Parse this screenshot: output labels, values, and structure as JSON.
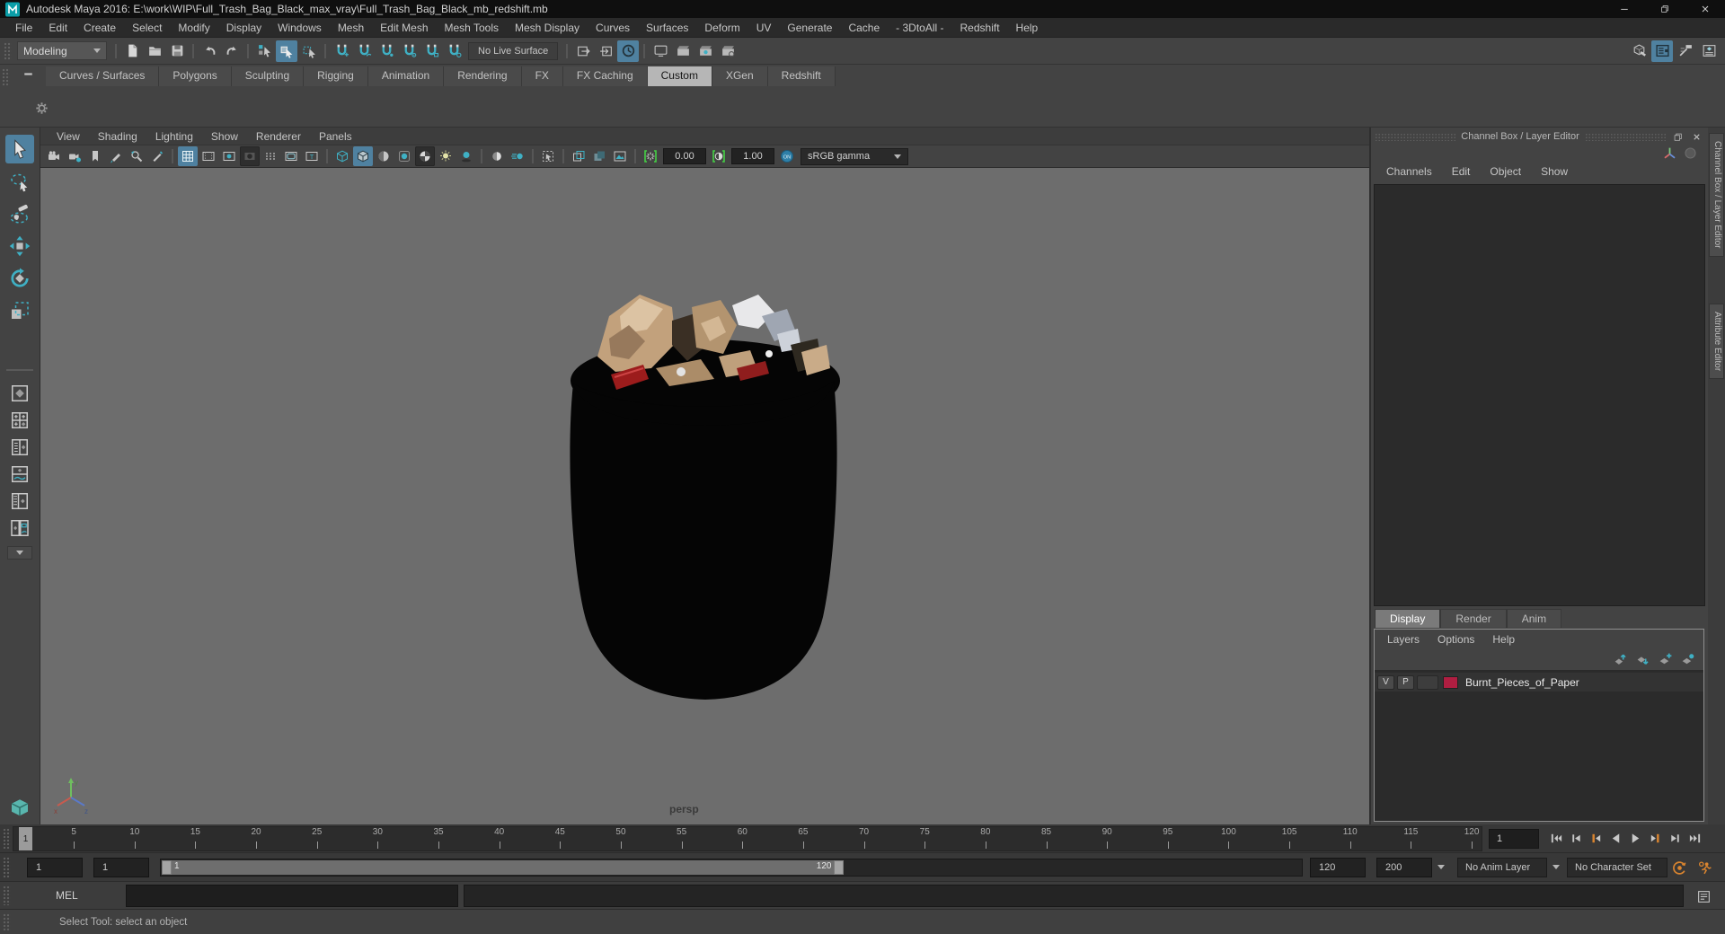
{
  "window": {
    "title": "Autodesk Maya 2016: E:\\work\\WIP\\Full_Trash_Bag_Black_max_vray\\Full_Trash_Bag_Black_mb_redshift.mb",
    "controls": [
      "minimize",
      "maximize",
      "close"
    ]
  },
  "menubar": {
    "items": [
      "File",
      "Edit",
      "Create",
      "Select",
      "Modify",
      "Display",
      "Windows",
      "Mesh",
      "Edit Mesh",
      "Mesh Tools",
      "Mesh Display",
      "Curves",
      "Surfaces",
      "Deform",
      "UV",
      "Generate",
      "Cache",
      "- 3DtoAll -",
      "Redshift",
      "Help"
    ]
  },
  "statusline": {
    "mode": "Modeling",
    "live_surface_label": "No Live Surface",
    "groups": [
      [
        "new-scene",
        "open-scene",
        "save-scene"
      ],
      [
        "undo",
        "redo"
      ],
      [
        "select-hierarchy",
        {
          "name": "select-object",
          "hl": "blue"
        },
        "select-component"
      ],
      [
        "snap-grid",
        "snap-curve",
        "snap-point",
        "snap-projected-center",
        "snap-view-plane",
        "make-live"
      ]
    ],
    "groups_after_live": [
      [
        "input-connections",
        "output-connections",
        {
          "name": "construction-history",
          "hl": "blue"
        }
      ],
      [
        "render-view",
        "render-current-frame",
        "ipr-render",
        "render-settings"
      ]
    ],
    "right_icons": [
      "modeling-toolkit",
      {
        "name": "attribute-editor",
        "hl": "blue"
      },
      "tool-settings",
      "channel-box"
    ]
  },
  "shelf": {
    "tabs": [
      "Curves / Surfaces",
      "Polygons",
      "Sculpting",
      "Rigging",
      "Animation",
      "Rendering",
      "FX",
      "FX Caching",
      "Custom",
      "XGen",
      "Redshift"
    ],
    "active": "Custom",
    "left_icons": [
      "shelf-menu"
    ],
    "area_icons": [
      "gear"
    ]
  },
  "toolbox": {
    "tools": [
      {
        "name": "select",
        "hl": "blue"
      },
      "lasso",
      "paint-select",
      "move",
      "rotate",
      "scale"
    ],
    "layouts": [
      "layout-single",
      "layout-four",
      "layout-two-vertical",
      "layout-two-horizontal",
      "layout-three",
      "layout-pair"
    ],
    "bottom": [
      "view-cube"
    ]
  },
  "viewport": {
    "menus": [
      "View",
      "Shading",
      "Lighting",
      "Show",
      "Renderer",
      "Panels"
    ],
    "toolbar_groups": [
      [
        "camera",
        "camera-attributes",
        "bookmark",
        "grease-pencil",
        "pan-zoom",
        "snapshot"
      ],
      [
        {
          "name": "grid",
          "hl": "blue"
        },
        "film-gate",
        "resolution-gate",
        {
          "name": "gate-mask",
          "hl": "dark"
        },
        "field-chart",
        "safe-action",
        "safe-title"
      ],
      [
        "wireframe-cube",
        {
          "name": "smooth-shade",
          "hl": "blue"
        },
        "flat-shade",
        "default-material",
        {
          "name": "textured",
          "hl": "dark"
        },
        "lights",
        "shadows"
      ],
      [
        "screen-space-ao",
        "motion-blur"
      ],
      [
        "isolate-select"
      ],
      [
        "overlap-planes",
        "stacked-planes",
        "image-plane"
      ]
    ],
    "exposure_icon": [
      "exposure"
    ],
    "contrast_icon": [
      "contrast"
    ],
    "on_icon": [
      "on-toggle"
    ],
    "exposure_label": "0.00",
    "contrast_label": "1.00",
    "gamma_mode": "sRGB gamma",
    "camera_label": "persp"
  },
  "channel_box": {
    "title": "Channel Box / Layer Editor",
    "header_icons": [
      "restore",
      "close-panel"
    ],
    "corner_icons": [
      "manip-axis",
      "speed-circle"
    ],
    "menus": [
      "Channels",
      "Edit",
      "Object",
      "Show"
    ],
    "side_tabs": [
      "Channel Box / Layer Editor",
      "Attribute Editor"
    ]
  },
  "layer_editor": {
    "tabs": [
      "Display",
      "Render",
      "Anim"
    ],
    "active_tab": "Display",
    "menus": [
      "Layers",
      "Options",
      "Help"
    ],
    "icons": [
      "move-layer-up",
      "move-layer-down",
      "create-empty-layer",
      "create-layer-from-selection"
    ],
    "layers": [
      {
        "visible": "V",
        "playback": "P",
        "color": "#b01e41",
        "name": "Burnt_Pieces_of_Paper"
      }
    ]
  },
  "timeline": {
    "current_frame": "1",
    "tick_labels": [
      5,
      10,
      15,
      20,
      25,
      30,
      35,
      40,
      45,
      50,
      55,
      60,
      65,
      70,
      75,
      80,
      85,
      90,
      95,
      100,
      105,
      110,
      115,
      120
    ],
    "range_start": 1,
    "range_end": 120,
    "current_time_field": "1",
    "playback_icons": [
      "go-to-start",
      "step-back",
      "previous-key",
      "play-backwards",
      "play-forwards",
      "next-key",
      "step-forward",
      "go-to-end"
    ]
  },
  "range_slider": {
    "animation_start": "1",
    "playback_start": "1",
    "playback_end": "120",
    "animation_end": "200",
    "bar_start_label": "1",
    "bar_end_label": "120",
    "anim_layer": "No Anim Layer",
    "character_set": "No Character Set",
    "icons": [
      "auto-keyframe",
      "animation-preferences"
    ]
  },
  "command_line": {
    "label": "MEL",
    "icons": [
      "script-editor"
    ]
  },
  "help_line": {
    "text": "Select Tool: select an object"
  },
  "colors": {
    "accent_blue": "#4f81a0",
    "icon_teal": "#3fb0c4",
    "key_orange": "#d9842f",
    "layer_swatch": "#b01e41",
    "viewport_bg": "#6d6d6d"
  }
}
